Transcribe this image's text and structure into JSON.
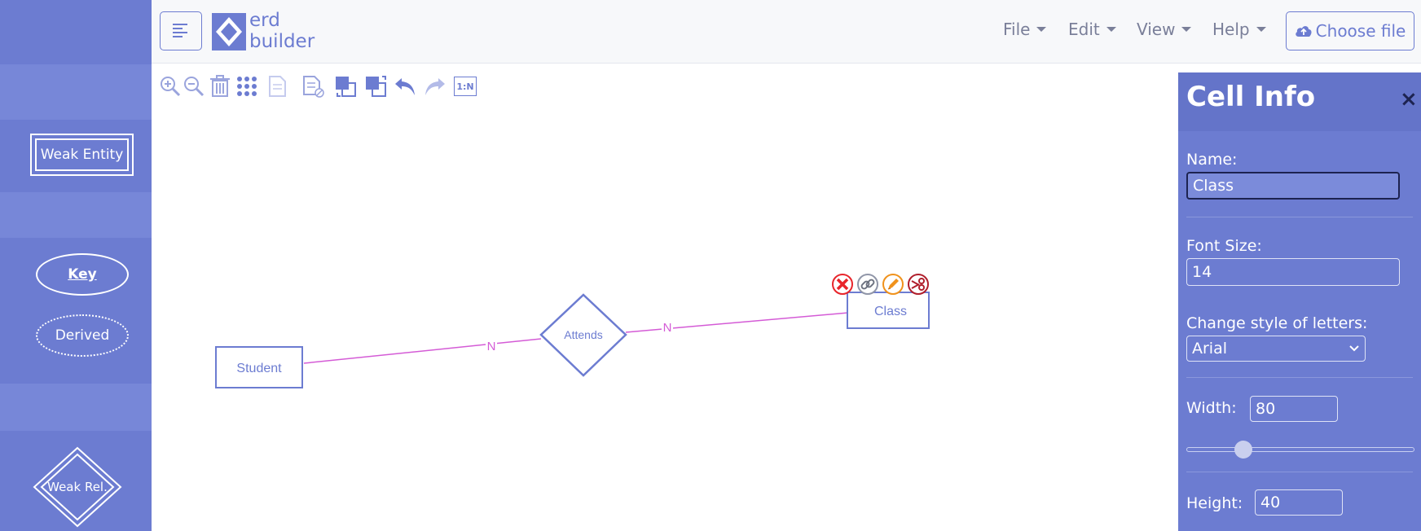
{
  "app": {
    "logo_line1": "erd",
    "logo_line2": "builder"
  },
  "menu": {
    "file": "File",
    "edit": "Edit",
    "view": "View",
    "help": "Help",
    "choose_file": "Choose file"
  },
  "palette": {
    "weak_entity": "Weak Entity",
    "key": "Key",
    "derived": "Derived",
    "weak_relationship": "Weak Rel."
  },
  "toolbar": {
    "cardinality_label": "1:N"
  },
  "diagram": {
    "entities": [
      "Student",
      "Class"
    ],
    "relationship": "Attends",
    "link_labels": [
      "N",
      "N"
    ]
  },
  "panel": {
    "title": "Cell Info",
    "close": "×",
    "name_label": "Name:",
    "name_value": "Class",
    "font_size_label": "Font Size:",
    "font_size_value": "14",
    "style_label": "Change style of letters:",
    "style_value": "Arial",
    "width_label": "Width:",
    "width_value": "80",
    "height_label": "Height:",
    "height_value": "40"
  },
  "colors": {
    "accent": "#6c7cd1",
    "link": "#d45bd6",
    "shape_stroke": "#6c7cd1",
    "delete": "#e8252b",
    "edit": "#f0921c",
    "cut": "#b01f2c"
  }
}
